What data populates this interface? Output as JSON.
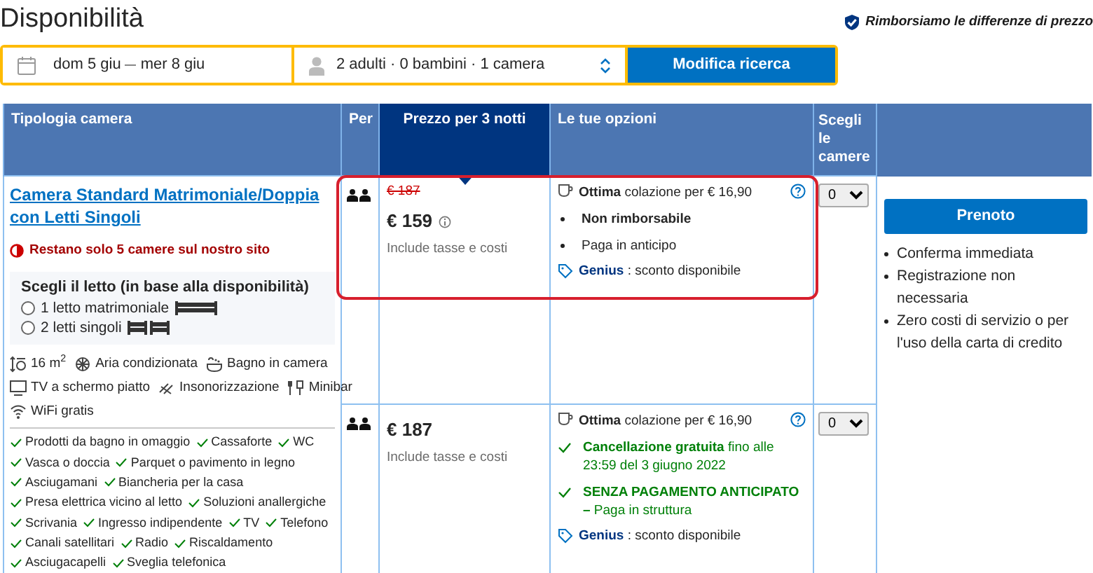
{
  "title": "Disponibilità",
  "price_match": "Rimborsiamo le differenze di prezzo",
  "search": {
    "date_start": "dom 5 giu",
    "date_end": "mer 8 giu",
    "guests": "2 adulti · 0 bambini · 1 camera",
    "button": "Modifica ricerca"
  },
  "table": {
    "columns": [
      {
        "label": "Tipologia camera",
        "selected": false
      },
      {
        "label": "Per",
        "selected": false
      },
      {
        "label": "Prezzo per 3 notti",
        "selected": true
      },
      {
        "label": "Le tue opzioni",
        "selected": false
      },
      {
        "label": "Scegli le camere",
        "selected": false
      }
    ]
  },
  "room": {
    "name": "Camera Standard Matrimoniale/Doppia con Letti Singoli",
    "scarcity": "Restano solo 5 camere sul nostro sito",
    "bed_title": "Scegli il letto (in base alla disponibilità)",
    "beds": [
      {
        "label": "1 letto matrimoniale",
        "kind": "double",
        "selected": false
      },
      {
        "label": "2 letti singoli",
        "kind": "twin",
        "selected": false
      }
    ],
    "feature_rows": [
      [
        {
          "kind": "size",
          "text": "16 m$^{2}$"
        },
        {
          "kind": "ac",
          "text": "Aria condizionata"
        },
        {
          "kind": "bath",
          "text": "Bagno in camera"
        }
      ],
      [
        {
          "kind": "tv",
          "text": "TV a schermo piatto"
        },
        {
          "kind": "soundproof",
          "text": "Insonorizzazione"
        },
        {
          "kind": "minibar",
          "text": "Minibar"
        }
      ],
      [
        {
          "kind": "wifi",
          "text": "WiFi gratis"
        }
      ]
    ],
    "amenity_rows": [
      [
        "Prodotti da bagno in omaggio",
        "Cassaforte",
        "WC"
      ],
      [
        "Vasca o doccia",
        "Parquet o pavimento in legno"
      ],
      [
        "Asciugamani",
        "Biancheria per la casa"
      ],
      [
        "Presa elettrica vicino al letto",
        "Soluzioni anallergiche"
      ],
      [
        "Scrivania",
        "Ingresso indipendente",
        "TV",
        "Telefono"
      ],
      [
        "Canali satellitari",
        "Radio",
        "Riscaldamento"
      ],
      [
        "Asciugacapelli",
        "Sveglia telefonica"
      ]
    ]
  },
  "options": [
    {
      "highlighted": true,
      "old_price": "€ 187",
      "price": "€ 159",
      "info_icon": true,
      "price_note": "Include tasse e costi",
      "breakfast": "**Ottima** colazione per € 16,90",
      "conditions": [
        {
          "kind": "bullet",
          "bold": true,
          "text": "Non rimborsabile"
        },
        {
          "kind": "bullet",
          "bold": false,
          "text": "Paga in anticipo"
        }
      ],
      "genius": "**Genius** : sconto disponibile",
      "quantity": "0"
    },
    {
      "highlighted": false,
      "price": "€ 187",
      "info_icon": false,
      "price_note": "Include tasse e costi",
      "breakfast": "**Ottima** colazione per € 16,90",
      "conditions": [
        {
          "kind": "check",
          "bold": false,
          "text": "**Cancellazione gratuita** fino alle 23:59 del 3 giugno 2022"
        },
        {
          "kind": "check",
          "bold": false,
          "text": "**SENZA PAGAMENTO ANTICIPATO –** Paga in struttura"
        }
      ],
      "genius": "**Genius** : sconto disponibile",
      "quantity": "0"
    }
  ],
  "booking": {
    "button": "Prenoto",
    "benefits": [
      "Conferma immediata",
      "Registrazione non necessaria",
      "Zero costi di servizio o per l'uso della carta di credito"
    ]
  }
}
